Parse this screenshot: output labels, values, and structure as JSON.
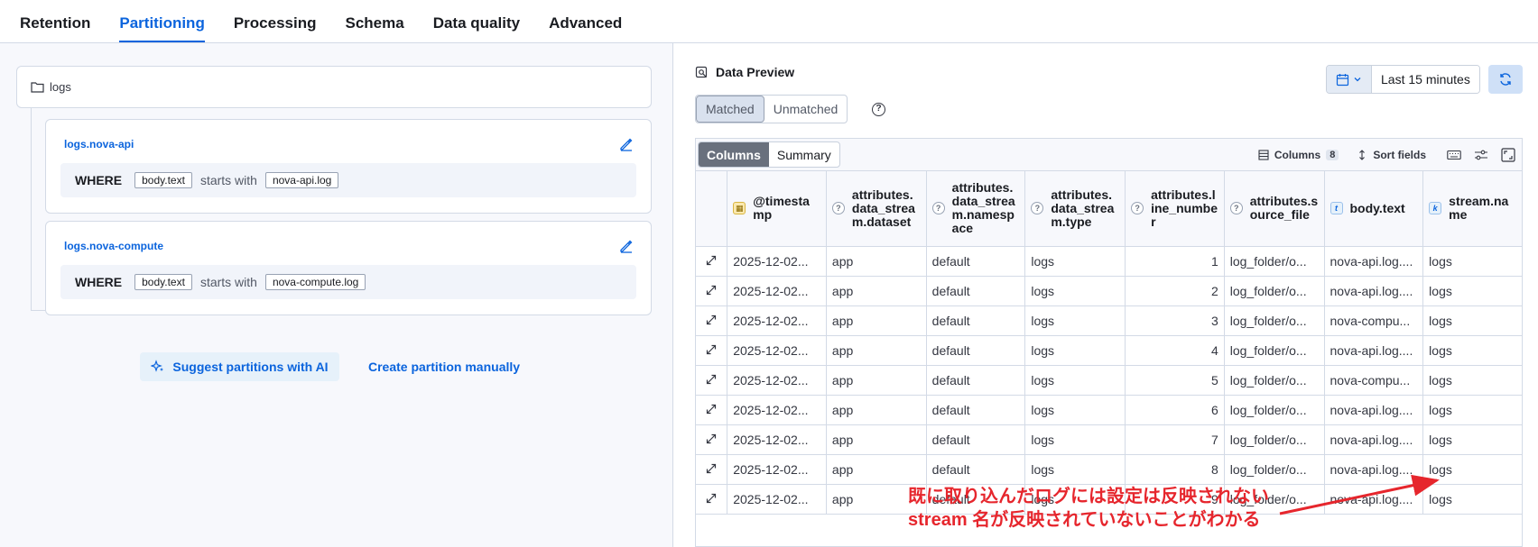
{
  "tabs": [
    {
      "label": "Retention",
      "active": false
    },
    {
      "label": "Partitioning",
      "active": true
    },
    {
      "label": "Processing",
      "active": false
    },
    {
      "label": "Schema",
      "active": false
    },
    {
      "label": "Data quality",
      "active": false
    },
    {
      "label": "Advanced",
      "active": false
    }
  ],
  "tree": {
    "root_label": "logs",
    "partitions": [
      {
        "name": "logs.nova-api",
        "where": "WHERE",
        "field": "body.text",
        "operator": "starts with",
        "value": "nova-api.log"
      },
      {
        "name": "logs.nova-compute",
        "where": "WHERE",
        "field": "body.text",
        "operator": "starts with",
        "value": "nova-compute.log"
      }
    ],
    "suggest_ai_label": "Suggest partitions with AI",
    "create_manual_label": "Create partition manually"
  },
  "preview": {
    "title": "Data Preview",
    "filter_tabs": [
      "Matched",
      "Unmatched"
    ],
    "active_filter": "Matched",
    "time_range": "Last 15 minutes",
    "view_tabs": [
      "Columns",
      "Summary"
    ],
    "active_view": "Columns",
    "columns_label": "Columns",
    "columns_count": "8",
    "sort_label": "Sort fields",
    "headers": [
      {
        "label": "@timestamp",
        "type": "date"
      },
      {
        "label": "attributes.data_stream.dataset",
        "type": "unk"
      },
      {
        "label": "attributes.data_stream.namespace",
        "type": "unk"
      },
      {
        "label": "attributes.data_stream.type",
        "type": "unk"
      },
      {
        "label": "attributes.line_number",
        "type": "unk"
      },
      {
        "label": "attributes.source_file",
        "type": "unk"
      },
      {
        "label": "body.text",
        "type": "txt"
      },
      {
        "label": "stream.name",
        "type": "kw"
      }
    ],
    "rows": [
      [
        "2025-12-02...",
        "app",
        "default",
        "logs",
        "1",
        "log_folder/o...",
        "nova-api.log....",
        "logs"
      ],
      [
        "2025-12-02...",
        "app",
        "default",
        "logs",
        "2",
        "log_folder/o...",
        "nova-api.log....",
        "logs"
      ],
      [
        "2025-12-02...",
        "app",
        "default",
        "logs",
        "3",
        "log_folder/o...",
        "nova-compu...",
        "logs"
      ],
      [
        "2025-12-02...",
        "app",
        "default",
        "logs",
        "4",
        "log_folder/o...",
        "nova-api.log....",
        "logs"
      ],
      [
        "2025-12-02...",
        "app",
        "default",
        "logs",
        "5",
        "log_folder/o...",
        "nova-compu...",
        "logs"
      ],
      [
        "2025-12-02...",
        "app",
        "default",
        "logs",
        "6",
        "log_folder/o...",
        "nova-api.log....",
        "logs"
      ],
      [
        "2025-12-02...",
        "app",
        "default",
        "logs",
        "7",
        "log_folder/o...",
        "nova-api.log....",
        "logs"
      ],
      [
        "2025-12-02...",
        "app",
        "default",
        "logs",
        "8",
        "log_folder/o...",
        "nova-api.log....",
        "logs"
      ],
      [
        "2025-12-02...",
        "app",
        "default",
        "logs",
        "9",
        "log_folder/o...",
        "nova-api.log....",
        "logs"
      ]
    ]
  },
  "annotation": {
    "line1": "既に取り込んだログには設定は反映されない",
    "line2": "stream 名が反映されていないことがわかる",
    "color": "#e6262d"
  },
  "colors": {
    "accent": "#0b64dd",
    "border": "#d3dae6"
  }
}
